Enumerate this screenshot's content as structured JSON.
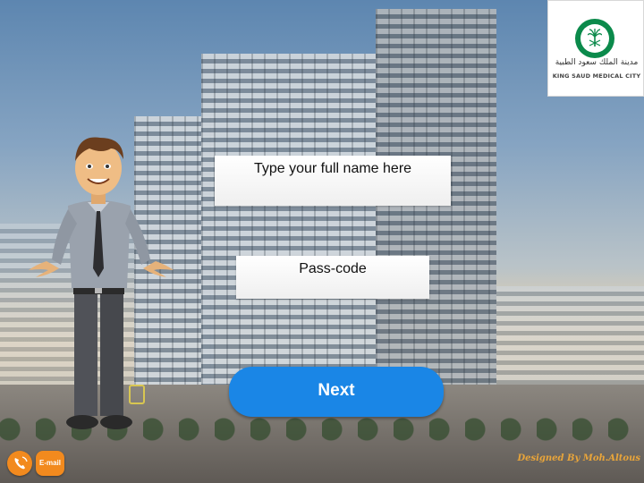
{
  "logo": {
    "arabic": "مدينة الملك سعود الطبية",
    "english": "KING SAUD MEDICAL CITY",
    "emblem_icon": "palm-swords-emblem-icon",
    "brand_color": "#0b8a4b"
  },
  "form": {
    "name_placeholder": "Type your full name here",
    "passcode_placeholder": "Pass-code",
    "next_label": "Next",
    "next_color": "#1a86e6"
  },
  "footer": {
    "phone_icon": "phone-icon",
    "email_label": "E-mail",
    "button_color": "#f28a1e",
    "credit": "Designed By Moh.Altous"
  },
  "character": {
    "icon": "presenter-character-icon"
  }
}
